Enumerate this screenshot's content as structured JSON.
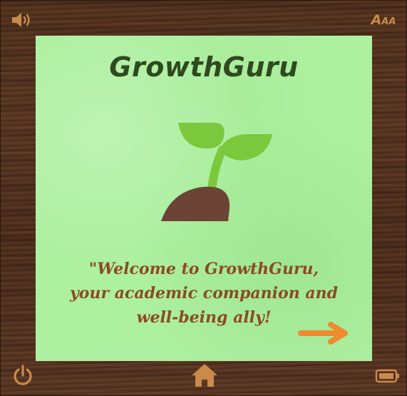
{
  "app": {
    "title": "GrowthGuru",
    "welcome_lines": [
      "\"Welcome to GrowthGuru,",
      "your academic companion and",
      "well-being ally!"
    ]
  },
  "toolbar": {
    "font_size_large": "A",
    "font_size_small": "AA"
  },
  "icons": {
    "sound": "speaker-icon",
    "font_size": "font-size-icon",
    "power": "power-icon",
    "home": "home-icon",
    "battery": "battery-icon",
    "next": "arrow-right-icon",
    "logo": "sprout-icon"
  },
  "colors": {
    "frame_wood": "#4a2c1a",
    "card_background": "#adf0a0",
    "title_text": "#2f4a1f",
    "welcome_text": "#8c4b22",
    "icon_accent": "#c98a4b",
    "next_arrow": "#ef8a2e",
    "sprout_leaf": "#7cc83c",
    "sprout_soil": "#6b4436"
  }
}
